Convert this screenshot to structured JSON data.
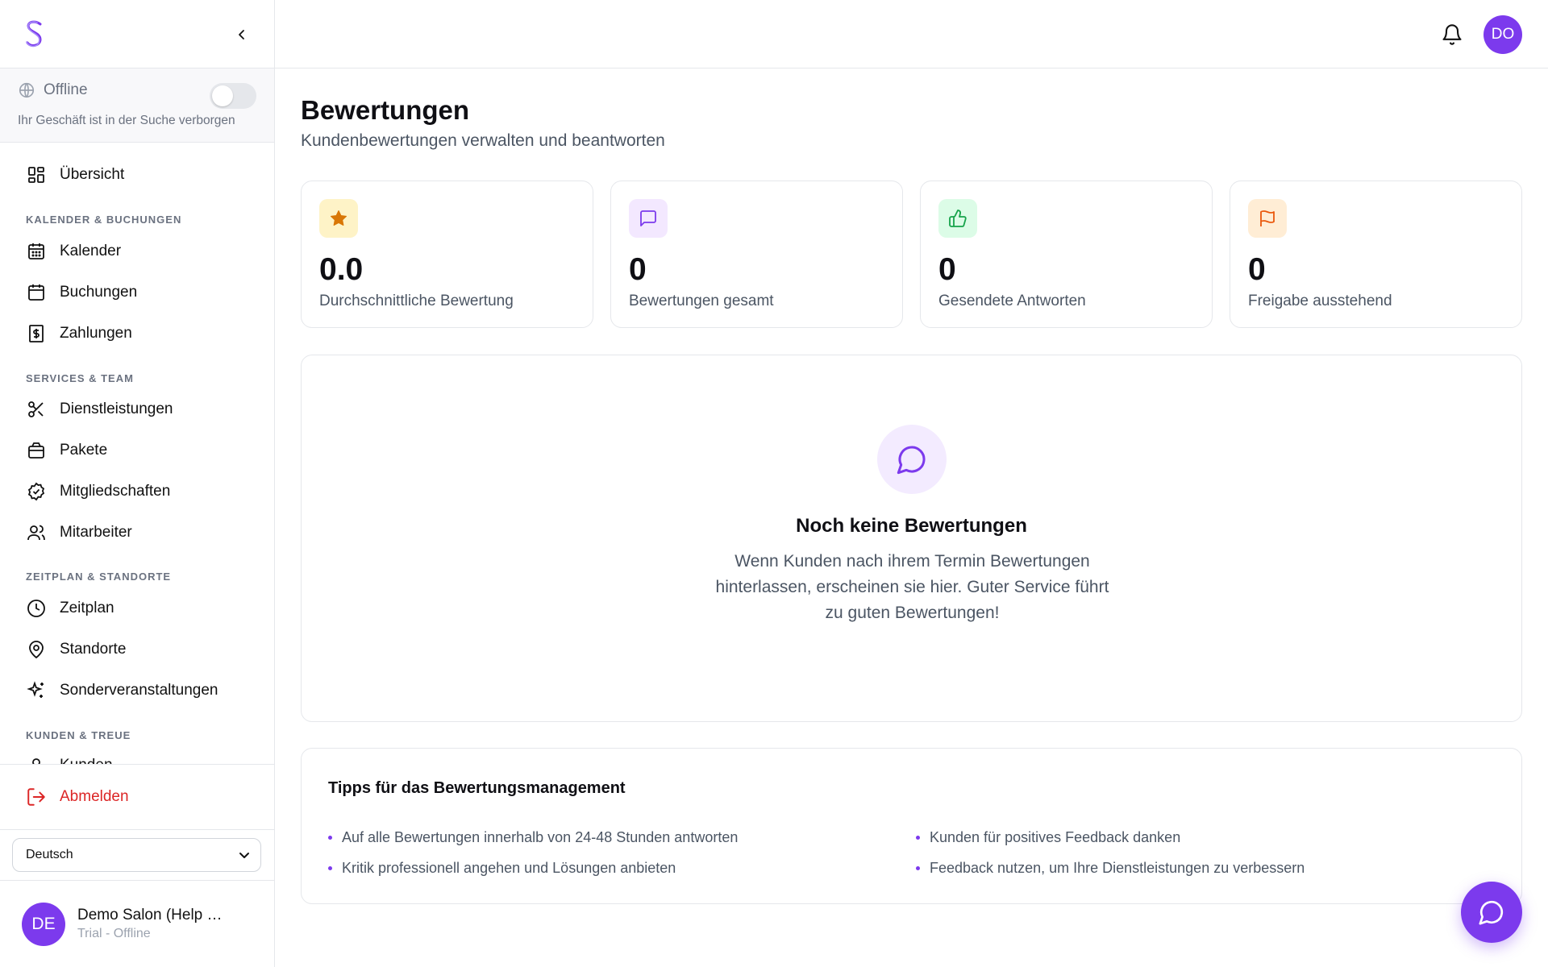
{
  "sidebar": {
    "status": {
      "label": "Offline",
      "description": "Ihr Geschäft ist in der Suche verborgen",
      "enabled": false
    },
    "overview": "Übersicht",
    "sections": {
      "calendar": "KALENDER & BUCHUNGEN",
      "services": "SERVICES & TEAM",
      "schedule": "ZEITPLAN & STANDORTE",
      "customers": "KUNDEN & TREUE"
    },
    "items": {
      "kalender": "Kalender",
      "buchungen": "Buchungen",
      "zahlungen": "Zahlungen",
      "dienstleistungen": "Dienstleistungen",
      "pakete": "Pakete",
      "mitgliedschaften": "Mitgliedschaften",
      "mitarbeiter": "Mitarbeiter",
      "zeitplan": "Zeitplan",
      "standorte": "Standorte",
      "sonderveranstaltungen": "Sonderveranstaltungen",
      "kunden": "Kunden"
    },
    "logout": "Abmelden",
    "language": "Deutsch",
    "user": {
      "initials": "DE",
      "name": "Demo Salon (Help …",
      "status": "Trial - Offline"
    }
  },
  "header": {
    "avatar_initials": "DO"
  },
  "page": {
    "title": "Bewertungen",
    "subtitle": "Kundenbewertungen verwalten und beantworten"
  },
  "stats": [
    {
      "value": "0.0",
      "label": "Durchschnittliche Bewertung",
      "icon": "star-icon"
    },
    {
      "value": "0",
      "label": "Bewertungen gesamt",
      "icon": "message-square-icon"
    },
    {
      "value": "0",
      "label": "Gesendete Antworten",
      "icon": "thumbs-up-icon"
    },
    {
      "value": "0",
      "label": "Freigabe ausstehend",
      "icon": "flag-icon"
    }
  ],
  "empty_state": {
    "title": "Noch keine Bewertungen",
    "text": "Wenn Kunden nach ihrem Termin Bewertungen hinterlassen, erscheinen sie hier. Guter Service führt zu guten Bewertungen!"
  },
  "tips": {
    "title": "Tipps für das Bewertungsmanagement",
    "items": [
      "Auf alle Bewertungen innerhalb von 24-48 Stunden antworten",
      "Kritik professionell angehen und Lösungen anbieten",
      "Kunden für positives Feedback danken",
      "Feedback nutzen, um Ihre Dienstleistungen zu verbessern"
    ]
  },
  "colors": {
    "accent": "#7c3aed",
    "danger": "#dc2626",
    "star_bg": "#fef3c7",
    "message_bg": "#f3e8ff",
    "thumbs_bg": "#dcfce7",
    "flag_bg": "#ffedd5"
  }
}
